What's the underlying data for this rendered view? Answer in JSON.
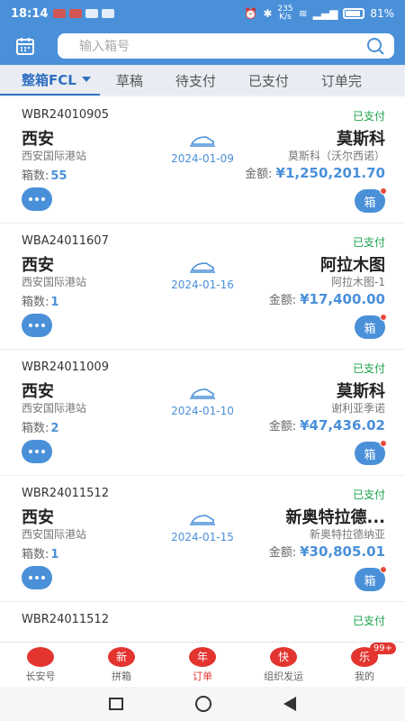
{
  "status_bar": {
    "time": "18:14",
    "speed": "235\nK/s",
    "battery": "81%"
  },
  "search": {
    "placeholder": "输入箱号"
  },
  "tabs": [
    {
      "label": "整箱FCL",
      "active": true
    },
    {
      "label": "草稿"
    },
    {
      "label": "待支付"
    },
    {
      "label": "已支付"
    },
    {
      "label": "订单完"
    }
  ],
  "orders": [
    {
      "id": "WBR24010905",
      "status": "已支付",
      "origin": "西安",
      "origin_station": "西安国际港站",
      "count_label": "箱数:",
      "count": "55",
      "date": "2024-01-09",
      "dest": "莫斯科",
      "dest_station": "莫斯科（沃尔西诺）",
      "amount_label": "金额:",
      "amount": "¥1,250,201.70",
      "box_label": "箱"
    },
    {
      "id": "WBA24011607",
      "status": "已支付",
      "origin": "西安",
      "origin_station": "西安国际港站",
      "count_label": "箱数:",
      "count": "1",
      "date": "2024-01-16",
      "dest": "阿拉木图",
      "dest_station": "阿拉木图-1",
      "amount_label": "金额:",
      "amount": "¥17,400.00",
      "box_label": "箱"
    },
    {
      "id": "WBR24011009",
      "status": "已支付",
      "origin": "西安",
      "origin_station": "西安国际港站",
      "count_label": "箱数:",
      "count": "2",
      "date": "2024-01-10",
      "dest": "莫斯科",
      "dest_station": "谢利亚季诺",
      "amount_label": "金额:",
      "amount": "¥47,436.02",
      "box_label": "箱"
    },
    {
      "id": "WBR24011512",
      "status": "已支付",
      "origin": "西安",
      "origin_station": "西安国际港站",
      "count_label": "箱数:",
      "count": "1",
      "date": "2024-01-15",
      "dest": "新奥特拉德...",
      "dest_station": "新奥特拉德纳亚",
      "amount_label": "金额:",
      "amount": "¥30,805.01",
      "box_label": "箱"
    },
    {
      "id": "WBR24011512",
      "status": "已支付"
    }
  ],
  "bottom_nav": [
    {
      "label": "长安号",
      "icon_text": ""
    },
    {
      "label": "拼箱",
      "icon_text": "新"
    },
    {
      "label": "订单",
      "icon_text": "年",
      "active": true
    },
    {
      "label": "组织发运",
      "icon_text": "快"
    },
    {
      "label": "我的",
      "icon_text": "乐",
      "badge": "99+"
    }
  ],
  "colors": {
    "primary": "#4a90d9",
    "paid_green": "#1aa34a",
    "nav_red": "#e3342f"
  }
}
